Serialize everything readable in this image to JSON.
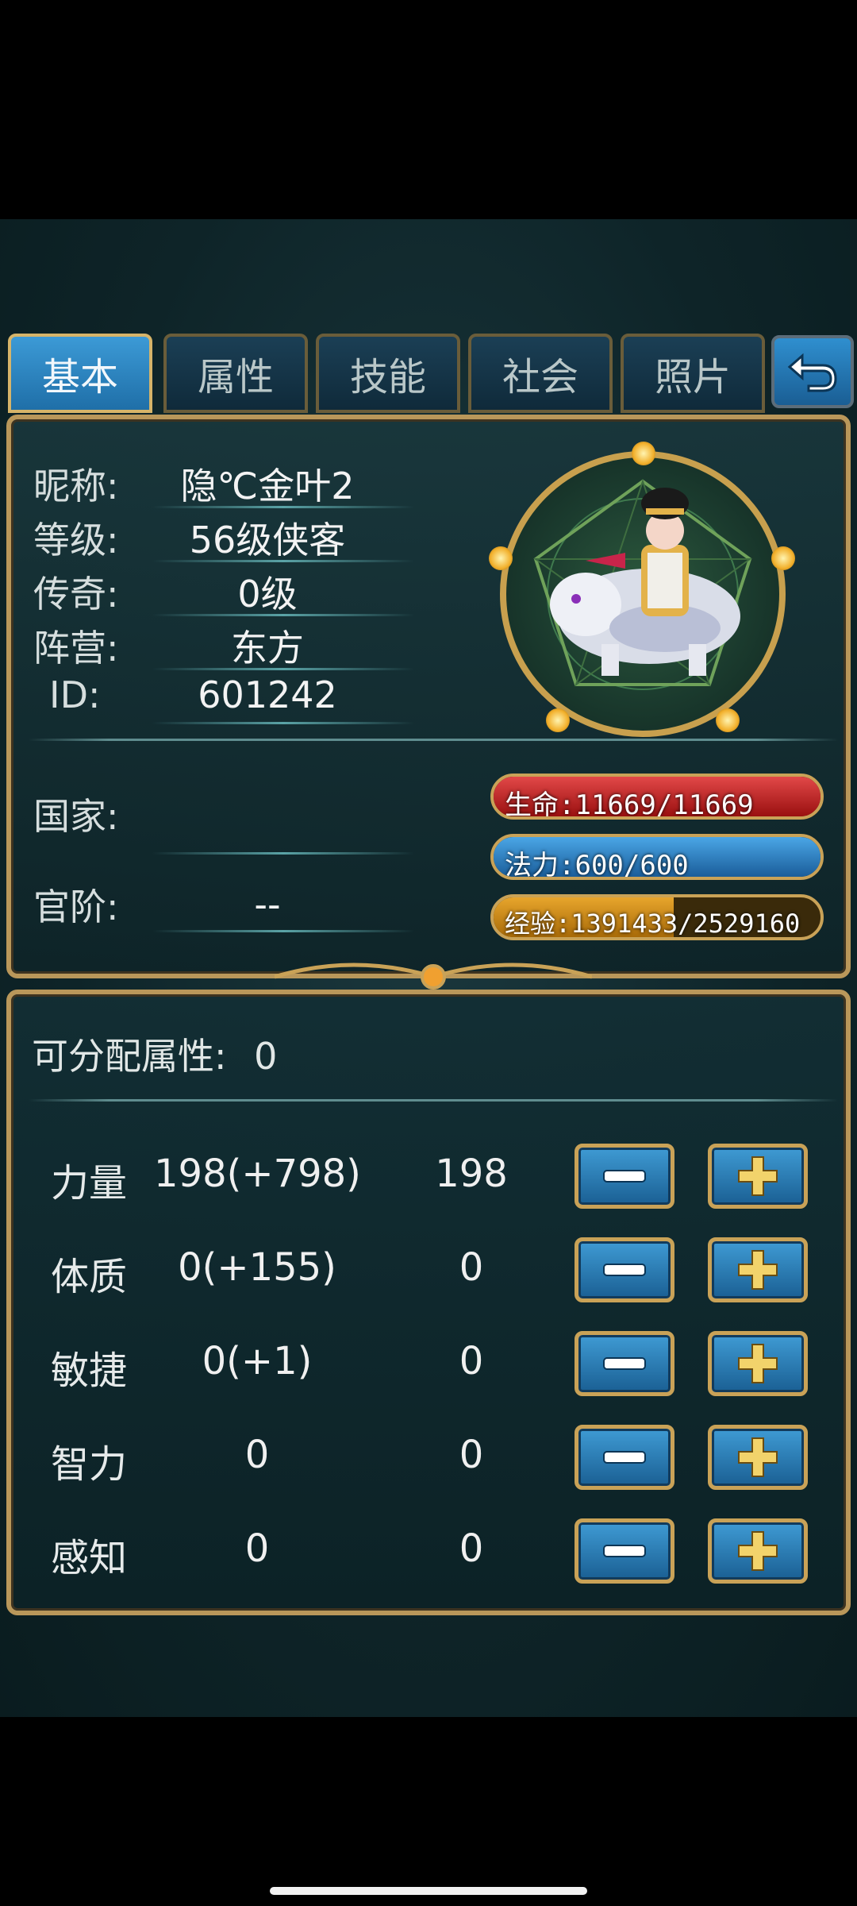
{
  "tabs": [
    {
      "label": "基本",
      "active": true
    },
    {
      "label": "属性",
      "active": false
    },
    {
      "label": "技能",
      "active": false
    },
    {
      "label": "社会",
      "active": false
    },
    {
      "label": "照片",
      "active": false
    }
  ],
  "profile": {
    "nickname_label": "昵称:",
    "nickname": "隐℃金叶2",
    "level_label": "等级:",
    "level": "56级侠客",
    "legend_label": "传奇:",
    "legend": "0级",
    "camp_label": "阵营:",
    "camp": "东方",
    "id_label": "ID:",
    "id": "601242",
    "country_label": "国家:",
    "country": "",
    "rank_label": "官阶:",
    "rank": "--"
  },
  "bars": {
    "hp": {
      "text": "生命:11669/11669",
      "fraction": 1.0
    },
    "mp": {
      "text": "法力:600/600",
      "fraction": 1.0
    },
    "xp": {
      "text": "经验:1391433/2529160",
      "fraction": 0.55
    }
  },
  "attributes": {
    "points_label": "可分配属性:",
    "points_value": "0",
    "rows": [
      {
        "name": "力量",
        "total": "198(+798)",
        "base": "198"
      },
      {
        "name": "体质",
        "total": "0(+155)",
        "base": "0"
      },
      {
        "name": "敏捷",
        "total": "0(+1)",
        "base": "0"
      },
      {
        "name": "智力",
        "total": "0",
        "base": "0"
      },
      {
        "name": "感知",
        "total": "0",
        "base": "0"
      }
    ]
  },
  "icons": {
    "back": "back-arrow-icon",
    "minus": "minus-icon",
    "plus": "plus-icon"
  },
  "colors": {
    "gold_border": "#b9975a",
    "tab_active": "#2f86c4",
    "hp": "#c62828",
    "mp": "#2d7cc0",
    "xp": "#d89018"
  }
}
